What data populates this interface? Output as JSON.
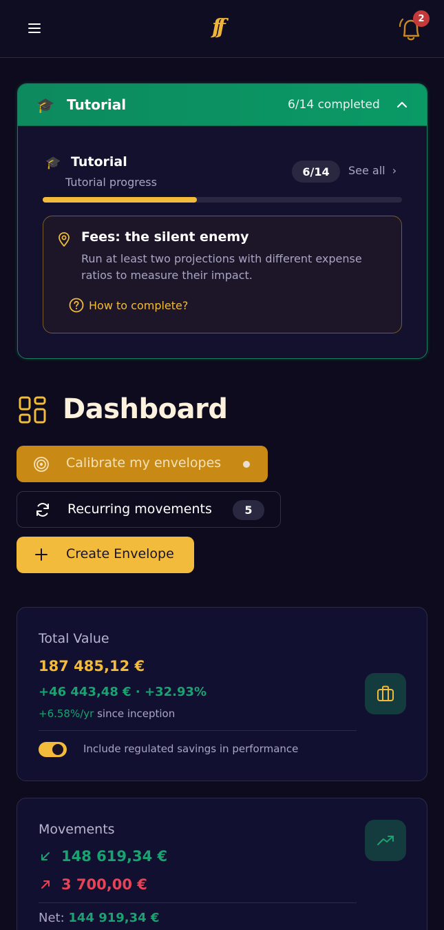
{
  "header": {
    "logo_text": "ff",
    "notifications_count": "2"
  },
  "tutorial": {
    "title": "Tutorial",
    "status": "6/14 completed",
    "sub_title": "Tutorial",
    "sub_desc": "Tutorial progress",
    "count": "6/14",
    "see_all": "See all",
    "progress_fraction": 0.43,
    "challenge": {
      "title": "Fees: the silent enemy",
      "description": "Run at least two projections with different expense ratios to measure their impact.",
      "how_to": "How to complete?"
    }
  },
  "dashboard": {
    "title": "Dashboard",
    "calibrate_label": "Calibrate my envelopes",
    "recurring_label": "Recurring movements",
    "recurring_count": "5",
    "create_label": "Create Envelope"
  },
  "total_value": {
    "label": "Total Value",
    "value": "187 485,12 €",
    "gain": "+46 443,48 € · +32.93%",
    "annual_rate": "+6.58%/yr",
    "since_text": " since inception",
    "toggle_label": "Include regulated savings in performance",
    "toggle_on": true
  },
  "movements": {
    "label": "Movements",
    "incoming": "148 619,34 €",
    "outgoing": "3 700,00 €",
    "net_label": "Net: ",
    "net_value": "144 919,34 €"
  },
  "colors": {
    "accent": "#f2bb3b",
    "success": "#19a370",
    "danger": "#e54356",
    "tutorial_header": "#0d8a5e",
    "background": "#0d0b1d"
  }
}
